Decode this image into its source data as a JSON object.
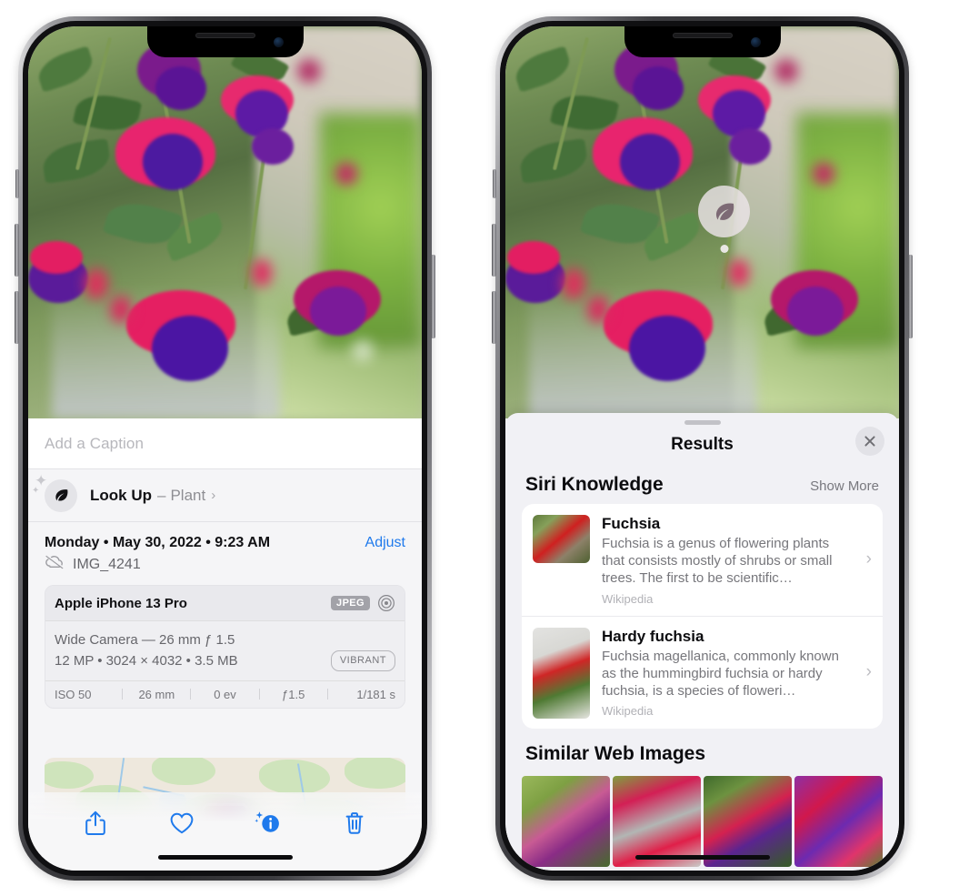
{
  "accent_colors": {
    "link_blue": "#1f7aec",
    "sheet_bg": "#f1f1f5",
    "card_white": "#ffffff",
    "muted_text": "#76767b"
  },
  "left_phone": {
    "name": "photos-info-screen",
    "caption": {
      "placeholder": "Add a Caption",
      "value": ""
    },
    "lookup": {
      "icon": "leaf-icon",
      "sparkle_icon": "sparkles-icon",
      "label": "Look Up",
      "dash": "–",
      "subject": "Plant",
      "chevron": "›"
    },
    "meta": {
      "date": "Monday • May 30, 2022 • 9:23 AM",
      "adjust_label": "Adjust",
      "cloud_icon": "cloud-slash-icon",
      "filename": "IMG_4241"
    },
    "camera_card": {
      "model": "Apple iPhone 13 Pro",
      "format_badge": "JPEG",
      "aperture_icon": "aperture-icon",
      "lens_line": "Wide Camera — 26 mm ƒ 1.5",
      "spec_line": "12 MP • 3024 × 4032 • 3.5 MB",
      "profile_badge": "VIBRANT",
      "exif": [
        "ISO 50",
        "26 mm",
        "0 ev",
        "ƒ1.5",
        "1/181 s"
      ]
    },
    "map": {
      "name": "location-map",
      "pin": "photo-thumbnail-pin"
    },
    "toolbar": [
      {
        "name": "share-button",
        "icon": "share-icon"
      },
      {
        "name": "favorite-button",
        "icon": "heart-icon"
      },
      {
        "name": "info-button",
        "icon": "info-sparkle-icon"
      },
      {
        "name": "delete-button",
        "icon": "trash-icon"
      }
    ]
  },
  "right_phone": {
    "name": "visual-lookup-results-screen",
    "photo_marker": {
      "icon": "leaf-icon",
      "name": "visual-lookup-marker"
    },
    "sheet": {
      "grabber": "sheet-grabber",
      "title": "Results",
      "close_icon": "close-icon"
    },
    "sections": [
      {
        "title": "Siri Knowledge",
        "action": "Show More",
        "entries": [
          {
            "title": "Fuchsia",
            "description": "Fuchsia is a genus of flowering plants that consists mostly of shrubs or small trees. The first to be scientific…",
            "source": "Wikipedia",
            "chevron": "›"
          },
          {
            "title": "Hardy fuchsia",
            "description": "Fuchsia magellanica, commonly known as the hummingbird fuchsia or hardy fuchsia, is a species of floweri…",
            "source": "Wikipedia",
            "chevron": "›"
          }
        ]
      },
      {
        "title": "Similar Web Images",
        "images": [
          {
            "name": "web-image-1"
          },
          {
            "name": "web-image-2"
          },
          {
            "name": "web-image-3"
          },
          {
            "name": "web-image-4"
          }
        ]
      }
    ]
  }
}
